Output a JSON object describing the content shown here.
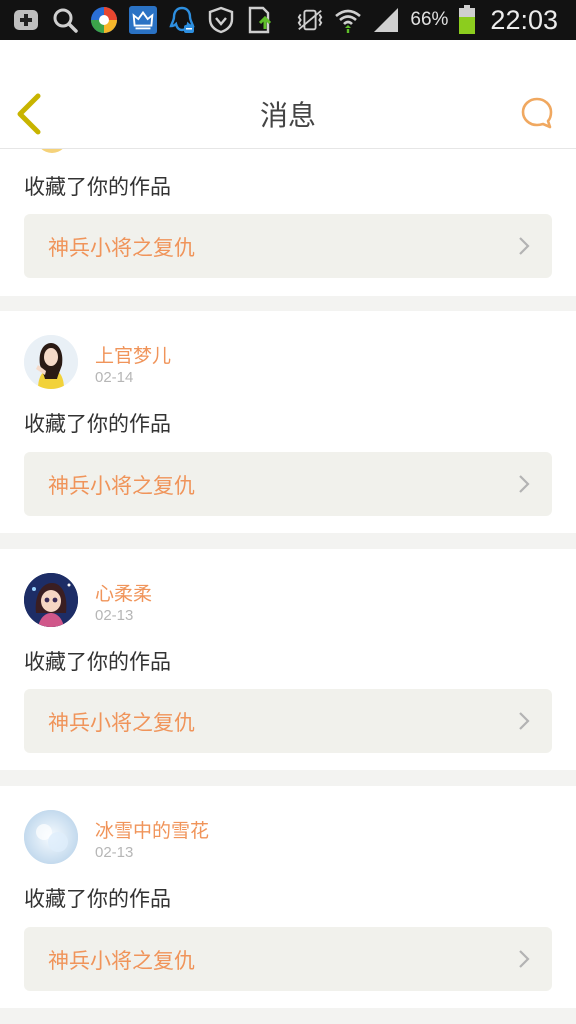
{
  "status_bar": {
    "battery": "66%",
    "time": "22:03",
    "icons": [
      "plus-app-icon",
      "search-icon",
      "colorful-app-icon",
      "crown-app-icon",
      "qq-notification-icon",
      "shield-icon",
      "download-icon",
      "vibrate-icon",
      "wifi-icon",
      "signal-icon",
      "battery-icon"
    ]
  },
  "header": {
    "title": "消息",
    "back_icon": "chevron-left-icon",
    "chat_icon": "chat-bubble-icon"
  },
  "messages": [
    {
      "user": "",
      "date": "",
      "action": "收藏了你的作品",
      "work_title": "神兵小将之复仇"
    },
    {
      "user": "上官梦儿",
      "date": "02-14",
      "action": "收藏了你的作品",
      "work_title": "神兵小将之复仇"
    },
    {
      "user": "心柔柔",
      "date": "02-13",
      "action": "收藏了你的作品",
      "work_title": "神兵小将之复仇"
    },
    {
      "user": "冰雪中的雪花",
      "date": "02-13",
      "action": "收藏了你的作品",
      "work_title": "神兵小将之复仇"
    }
  ],
  "colors": {
    "accent": "#f0945a",
    "header_icon": "#f0a860",
    "back_icon": "#c8b400",
    "card_bg": "#ffffff",
    "work_bg": "#f1f1ec",
    "page_bg": "#f3f3f1"
  }
}
